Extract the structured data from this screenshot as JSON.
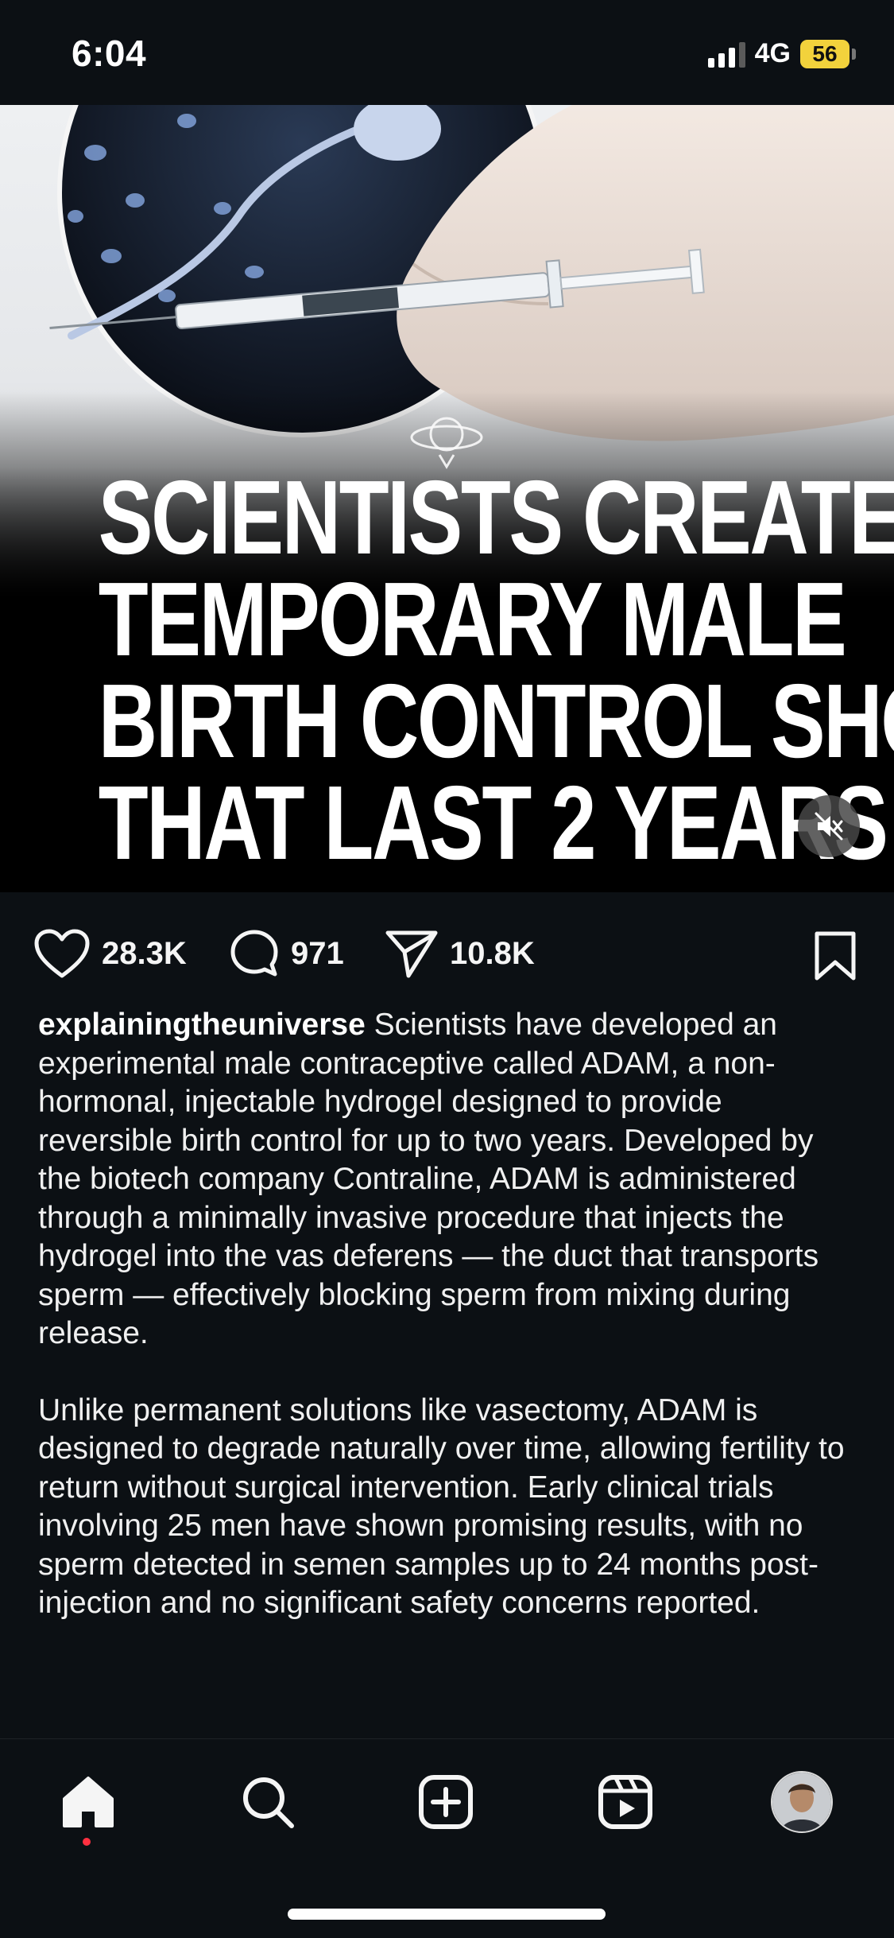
{
  "status_bar": {
    "time": "6:04",
    "network": "4G",
    "battery": "56"
  },
  "post": {
    "headline_lines": [
      "SCIENTISTS CREATE",
      "TEMPORARY MALE",
      "BIRTH CONTROL SHOTS",
      "THAT LAST 2 YEARS"
    ],
    "icons": {
      "logo": "planet-rocket-logo",
      "mute": "speaker-muted-icon",
      "like": "heart-icon",
      "comment": "comment-bubble-icon",
      "share": "paper-plane-icon",
      "save": "bookmark-icon"
    }
  },
  "actions": {
    "likes": "28.3K",
    "comments": "971",
    "shares": "10.8K"
  },
  "caption": {
    "username": "explainingtheuniverse",
    "paragraph1": "Scientists have developed an experimental male contraceptive called ADAM, a non-hormonal, injectable hydrogel designed to provide reversible birth control for up to two years. Developed by the biotech company Contraline, ADAM is administered through a minimally invasive procedure that injects the hydrogel into the vas deferens — the duct that transports sperm — effectively blocking sperm from mixing during release.",
    "paragraph2": "Unlike permanent solutions like vasectomy, ADAM is designed to degrade naturally over time, allowing fertility to return without surgical intervention. Early clinical trials involving 25 men have shown promising results, with no sperm detected in semen samples up to 24 months post-injection and no significant safety concerns reported."
  },
  "bottom_nav": {
    "items": [
      "home-icon",
      "search-icon",
      "create-post-icon",
      "reels-icon",
      "profile-avatar"
    ],
    "active": "home-icon",
    "notification_color": "#ff3040"
  },
  "colors": {
    "background": "#0c1014",
    "battery": "#f2d23c"
  }
}
